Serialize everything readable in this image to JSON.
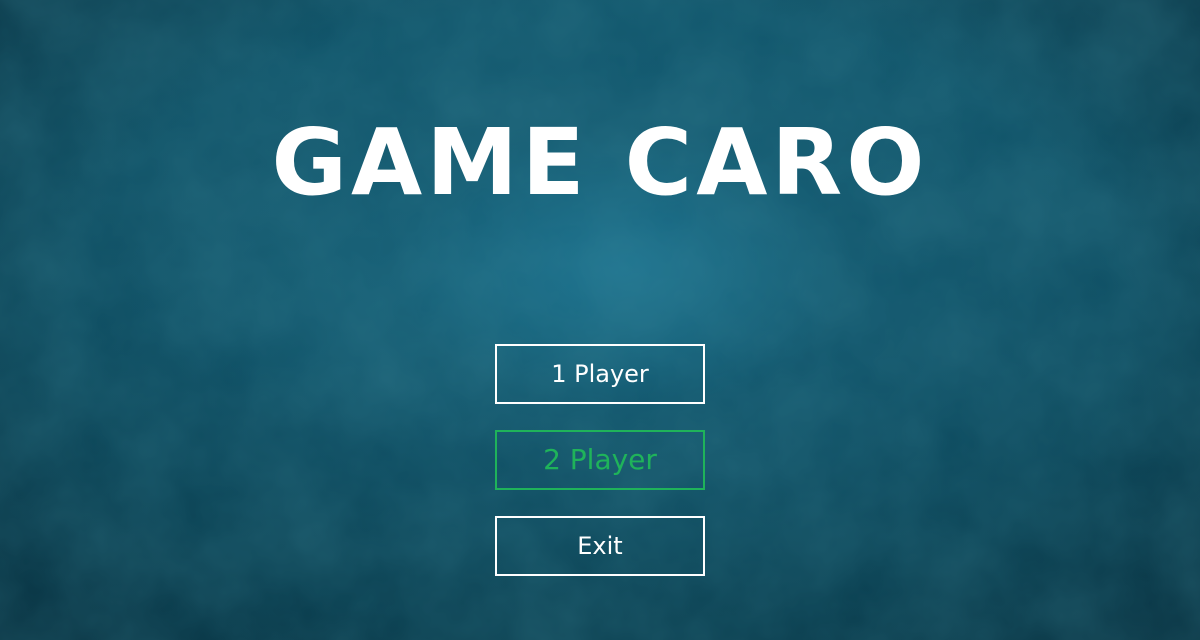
{
  "title": "GAME CARO",
  "menu": {
    "items": [
      {
        "label": "1 Player",
        "selected": false
      },
      {
        "label": "2 Player",
        "selected": true
      },
      {
        "label": "Exit",
        "selected": false
      }
    ]
  },
  "colors": {
    "background": "#0d4a5c",
    "text": "#ffffff",
    "selected": "#1fb35a"
  }
}
